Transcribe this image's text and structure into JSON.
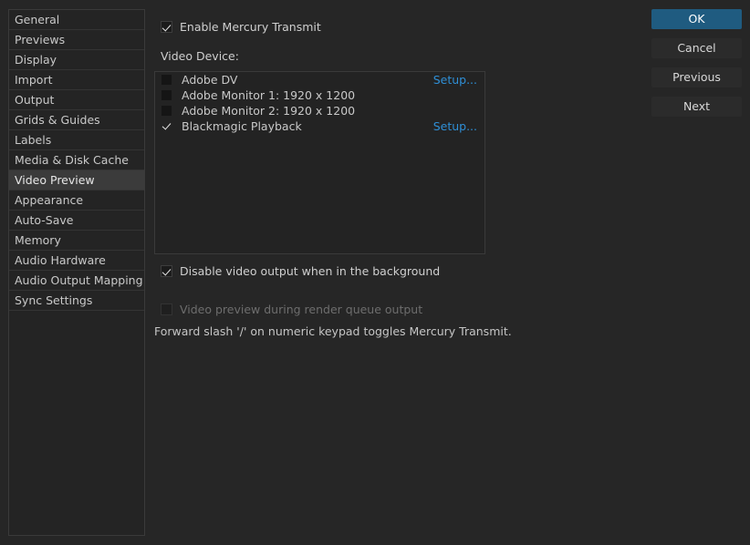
{
  "sidebar": {
    "items": [
      {
        "label": "General",
        "selected": false
      },
      {
        "label": "Previews",
        "selected": false
      },
      {
        "label": "Display",
        "selected": false
      },
      {
        "label": "Import",
        "selected": false
      },
      {
        "label": "Output",
        "selected": false
      },
      {
        "label": "Grids & Guides",
        "selected": false
      },
      {
        "label": "Labels",
        "selected": false
      },
      {
        "label": "Media & Disk Cache",
        "selected": false
      },
      {
        "label": "Video Preview",
        "selected": true
      },
      {
        "label": "Appearance",
        "selected": false
      },
      {
        "label": "Auto-Save",
        "selected": false
      },
      {
        "label": "Memory",
        "selected": false
      },
      {
        "label": "Audio Hardware",
        "selected": false
      },
      {
        "label": "Audio Output Mapping",
        "selected": false
      },
      {
        "label": "Sync Settings",
        "selected": false
      }
    ]
  },
  "main": {
    "enable_mercury_transmit": {
      "label": "Enable Mercury Transmit",
      "checked": true,
      "enabled": true
    },
    "video_device_label": "Video Device:",
    "devices": [
      {
        "name": "Adobe DV",
        "checked": false,
        "setup_label": "Setup..."
      },
      {
        "name": "Adobe Monitor 1: 1920 x 1200",
        "checked": false,
        "setup_label": ""
      },
      {
        "name": "Adobe Monitor 2: 1920 x 1200",
        "checked": false,
        "setup_label": ""
      },
      {
        "name": "Blackmagic Playback",
        "checked": true,
        "setup_label": "Setup..."
      }
    ],
    "disable_video_background": {
      "label": "Disable video output when in the background",
      "checked": true,
      "enabled": true
    },
    "video_preview_render_queue": {
      "label": "Video preview during render queue output",
      "checked": false,
      "enabled": false
    },
    "hint": "Forward slash '/' on numeric keypad toggles Mercury Transmit."
  },
  "buttons": [
    {
      "label": "OK",
      "primary": true
    },
    {
      "label": "Cancel",
      "primary": false
    },
    {
      "label": "Previous",
      "primary": false
    },
    {
      "label": "Next",
      "primary": false
    }
  ],
  "colors": {
    "window_background": "#262626",
    "panel_background": "#242424",
    "accent_primary": "#1f5b80",
    "link": "#2f8fd6",
    "text": "#cfcfcf",
    "text_disabled": "#6d6d6d",
    "selected_row": "#3b3b3b"
  }
}
